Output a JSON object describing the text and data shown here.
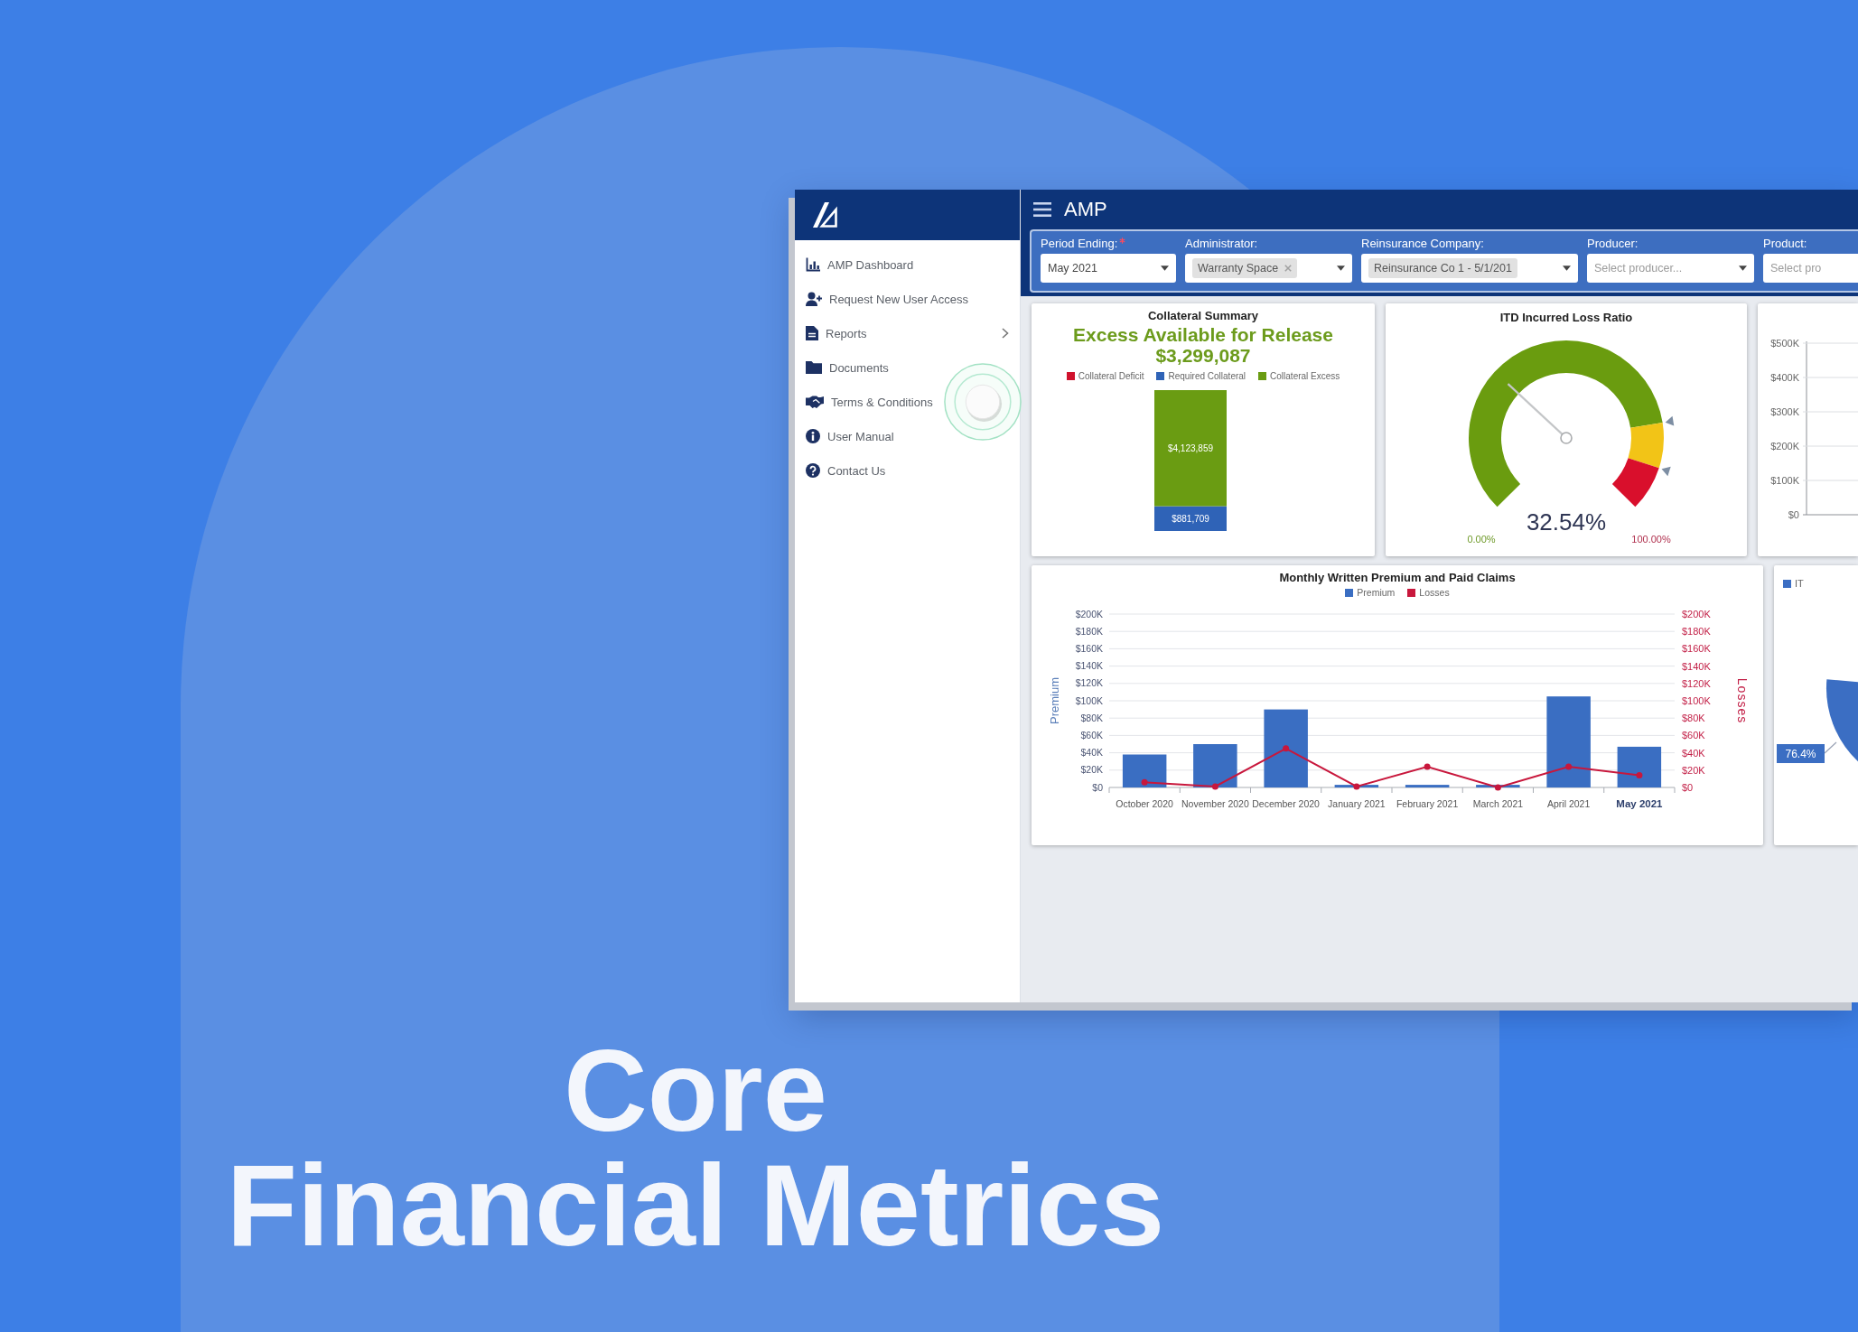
{
  "header": {
    "app_title": "AMP"
  },
  "sidebar": {
    "items": [
      {
        "label": "AMP Dashboard",
        "has_submenu": false,
        "tapped": false
      },
      {
        "label": "Request New User Access",
        "has_submenu": false,
        "tapped": false
      },
      {
        "label": "Reports",
        "has_submenu": true,
        "tapped": false
      },
      {
        "label": "Documents",
        "has_submenu": false,
        "tapped": false
      },
      {
        "label": "Terms & Conditions",
        "has_submenu": false,
        "tapped": true
      },
      {
        "label": "User Manual",
        "has_submenu": false,
        "tapped": false
      },
      {
        "label": "Contact Us",
        "has_submenu": false,
        "tapped": false
      }
    ]
  },
  "filters": [
    {
      "label": "Period Ending:",
      "required": true,
      "kind": "text",
      "value": "May 2021",
      "removable": false,
      "caret": true
    },
    {
      "label": "Administrator:",
      "required": false,
      "kind": "chip",
      "value": "Warranty Space",
      "removable": true,
      "caret": true
    },
    {
      "label": "Reinsurance Company:",
      "required": false,
      "kind": "chip",
      "value": "Reinsurance Co 1 - 5/1/201",
      "removable": false,
      "caret": true
    },
    {
      "label": "Producer:",
      "required": false,
      "kind": "empty",
      "placeholder": "Select producer...",
      "removable": false,
      "caret": true
    },
    {
      "label": "Product:",
      "required": false,
      "kind": "empty",
      "placeholder": "Select pro",
      "removable": false,
      "caret": false
    }
  ],
  "collateral_summary": {
    "title": "Collateral Summary",
    "headline": "Excess Available for Release",
    "amount": "$3,299,087",
    "legend": [
      {
        "label": "Collateral Deficit",
        "color": "#d0122d"
      },
      {
        "label": "Required Collateral",
        "color": "#2f63b7"
      },
      {
        "label": "Collateral Excess",
        "color": "#6a9c12"
      }
    ],
    "chart_data": {
      "type": "bar",
      "stacked": true,
      "series": [
        {
          "color": "#2f63b7",
          "values": [
            881709
          ],
          "value_labels": [
            "$881,709"
          ]
        },
        {
          "color": "#6a9c12",
          "values": [
            4123859
          ],
          "value_labels": [
            "$4,123,859"
          ]
        }
      ]
    }
  },
  "loss_ratio": {
    "title": "ITD Incurred Loss Ratio",
    "level": 0.3254,
    "reading": "32.54%",
    "min_label": "0.00%",
    "max_label": "100.00%"
  },
  "partial_chart": {
    "y_tick_labels": [
      "$500K",
      "$400K",
      "$300K",
      "$200K",
      "$100K",
      "$0"
    ]
  },
  "monthly_chart": {
    "chart_data": {
      "type": "bar",
      "title": "Monthly Written Premium and Paid Claims",
      "legend": "top",
      "grid": true,
      "ylabel": "Premium",
      "y2label": "Losses",
      "categories": [
        "October 2020",
        "November 2020",
        "December 2020",
        "January 2021",
        "February 2021",
        "March 2021",
        "April 2021",
        "May 2021"
      ],
      "ylim": [
        0,
        200000
      ],
      "y2lim": [
        0,
        200000
      ],
      "yticks": [
        {
          "value": 0,
          "label": "$0"
        },
        {
          "value": 20000,
          "label": "$20K"
        },
        {
          "value": 40000,
          "label": "$40K"
        },
        {
          "value": 60000,
          "label": "$60K"
        },
        {
          "value": 80000,
          "label": "$80K"
        },
        {
          "value": 100000,
          "label": "$100K"
        },
        {
          "value": 120000,
          "label": "$120K"
        },
        {
          "value": 140000,
          "label": "$140K"
        },
        {
          "value": 160000,
          "label": "$160K"
        },
        {
          "value": 180000,
          "label": "$180K"
        },
        {
          "value": 200000,
          "label": "$200K"
        }
      ],
      "y2ticks": [
        {
          "value": 0,
          "label": "$0"
        },
        {
          "value": 20000,
          "label": "$20K"
        },
        {
          "value": 40000,
          "label": "$40K"
        },
        {
          "value": 60000,
          "label": "$60K"
        },
        {
          "value": 80000,
          "label": "$80K"
        },
        {
          "value": 100000,
          "label": "$100K"
        },
        {
          "value": 120000,
          "label": "$120K"
        },
        {
          "value": 140000,
          "label": "$140K"
        },
        {
          "value": 160000,
          "label": "$160K"
        },
        {
          "value": 180000,
          "label": "$180K"
        },
        {
          "value": 200000,
          "label": "$200K"
        }
      ],
      "series": [
        {
          "name": "Premium",
          "type": "bar",
          "color": "#3a6ec2",
          "values": [
            38000,
            50000,
            90000,
            3000,
            3000,
            3000,
            105000,
            47000
          ]
        },
        {
          "name": "Losses",
          "type": "line",
          "marker": "circle",
          "color": "#c8173c",
          "values": [
            6000,
            1000,
            45000,
            1000,
            24000,
            0,
            24000,
            14000
          ]
        }
      ]
    },
    "highlighted": [
      false,
      false,
      false,
      false,
      false,
      false,
      false,
      true
    ]
  },
  "share_chart": {
    "legend": [
      {
        "label": "IT",
        "color": "#3b6ec3"
      }
    ],
    "slice_label": "76.4%"
  },
  "headline_lines": [
    "Core",
    "Financial Metrics"
  ]
}
